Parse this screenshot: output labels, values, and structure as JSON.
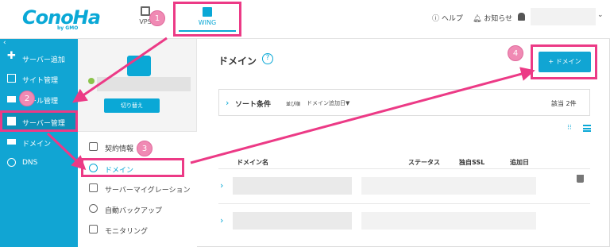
{
  "header": {
    "logo": "ConoHa",
    "logo_sub": "by GMO",
    "nav_vps": "VPS",
    "nav_wing": "WING",
    "help": "ヘルプ",
    "news": "お知らせ"
  },
  "badges": [
    "1",
    "2",
    "3",
    "4"
  ],
  "sidebar": {
    "items": [
      {
        "label": "サーバー追加",
        "icon": "plus-icon"
      },
      {
        "label": "サイト管理",
        "icon": "window-icon"
      },
      {
        "label": "メール管理",
        "icon": "mail-icon"
      },
      {
        "label": "サーバー管理",
        "icon": "server-icon"
      },
      {
        "label": "ドメイン",
        "icon": "domain-icon"
      },
      {
        "label": "DNS",
        "icon": "globe-icon"
      }
    ]
  },
  "server_panel": {
    "switch_button": "切り替え"
  },
  "submenu": {
    "items": [
      {
        "label": "契約情報",
        "icon": "contract-icon"
      },
      {
        "label": "ドメイン",
        "icon": "globe-icon"
      },
      {
        "label": "サーバーマイグレーション",
        "icon": "migration-icon"
      },
      {
        "label": "自動バックアップ",
        "icon": "backup-icon"
      },
      {
        "label": "モニタリング",
        "icon": "monitor-icon"
      }
    ]
  },
  "main": {
    "title": "ドメイン",
    "help_glyph": "?",
    "add_button": "+ ドメイン",
    "sort": {
      "label": "ソート条件",
      "order_label": "並び順",
      "order_value": "ドメイン追加日▼",
      "count": "該当 2件"
    },
    "table": {
      "headers": [
        "ドメイン名",
        "ステータス",
        "独自SSL",
        "追加日"
      ]
    }
  },
  "colors": {
    "brand": "#11a5d3",
    "highlight": "#ec3a86",
    "badge": "#f08ab4"
  }
}
